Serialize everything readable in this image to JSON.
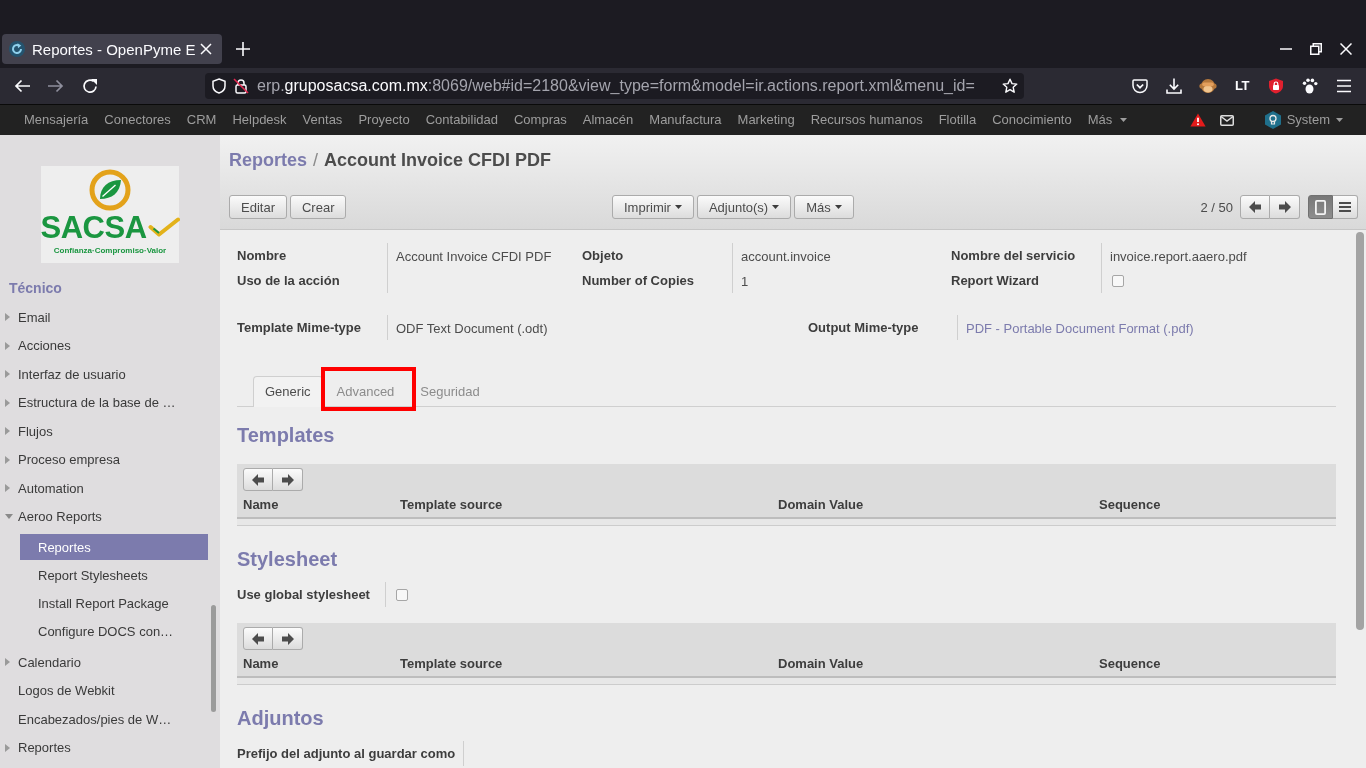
{
  "browser": {
    "tab_title": "Reportes - OpenPyme E",
    "address": {
      "subdomain": "erp.",
      "domain": "gruposacsa.com.mx",
      "path": ":8069/web#id=2180&view_type=form&model=ir.actions.report.xml&menu_id="
    },
    "extension_label": "LT"
  },
  "menu_bar": {
    "items": [
      "Mensajería",
      "Conectores",
      "CRM",
      "Helpdesk",
      "Ventas",
      "Proyecto",
      "Contabilidad",
      "Compras",
      "Almacén",
      "Manufactura",
      "Marketing",
      "Recursos humanos",
      "Flotilla",
      "Conocimiento"
    ],
    "more": "Más",
    "user": "System"
  },
  "sidebar": {
    "logo": {
      "name": "SACSA",
      "tagline": "Confianza·Compromiso·Valor"
    },
    "section": "Técnico",
    "items": [
      {
        "label": "Email",
        "kind": "folder",
        "expanded": false,
        "selected": false
      },
      {
        "label": "Acciones",
        "kind": "folder",
        "expanded": false,
        "selected": false
      },
      {
        "label": "Interfaz de usuario",
        "kind": "folder",
        "expanded": false,
        "selected": false
      },
      {
        "label": "Estructura de la base de …",
        "kind": "folder",
        "expanded": false,
        "selected": false
      },
      {
        "label": "Flujos",
        "kind": "folder",
        "expanded": false,
        "selected": false
      },
      {
        "label": "Proceso empresa",
        "kind": "folder",
        "expanded": false,
        "selected": false
      },
      {
        "label": "Automation",
        "kind": "folder",
        "expanded": false,
        "selected": false
      },
      {
        "label": "Aeroo Reports",
        "kind": "folder",
        "expanded": true,
        "selected": false,
        "children": [
          {
            "label": "Reportes",
            "kind": "leaf",
            "selected": true
          },
          {
            "label": "Report Stylesheets",
            "kind": "leaf",
            "selected": false
          },
          {
            "label": "Install Report Package",
            "kind": "leaf",
            "selected": false
          },
          {
            "label": "Configure DOCS con…",
            "kind": "leaf",
            "selected": false
          }
        ]
      },
      {
        "label": "Calendario",
        "kind": "folder",
        "expanded": false,
        "selected": false
      },
      {
        "label": "Logos de Webkit",
        "kind": "leaf",
        "selected": false
      },
      {
        "label": "Encabezados/pies de W…",
        "kind": "leaf",
        "selected": false
      },
      {
        "label": "Reportes",
        "kind": "folder",
        "expanded": false,
        "selected": false
      }
    ]
  },
  "form": {
    "breadcrumb": {
      "parent": "Reportes",
      "separator": "/",
      "current": "Account Invoice CFDI PDF"
    },
    "buttons": [
      "Editar",
      "Crear"
    ],
    "menus": [
      "Imprimir",
      "Adjunto(s)",
      "Más"
    ],
    "pager": "2 / 50",
    "views": [
      {
        "kind": "form",
        "selected": true
      },
      {
        "kind": "list",
        "selected": false
      }
    ],
    "field_rows": [
      {
        "fields": [
          {
            "label": "Nombre",
            "kind": "text",
            "value": "Account Invoice CFDI PDF"
          },
          {
            "label": "Objeto",
            "kind": "text",
            "value": "account.invoice"
          },
          {
            "label": "Nombre del servicio",
            "kind": "text",
            "value": "invoice.report.aaero.pdf"
          }
        ]
      },
      {
        "fields": [
          {
            "label": "Uso de la acción",
            "kind": "text"
          },
          {
            "label": "Number of Copies",
            "kind": "text",
            "value": "1"
          },
          {
            "label": "Report Wizard",
            "kind": "checkbox",
            "checked": false
          }
        ]
      },
      {
        "fields": [
          {
            "label": "Template Mime-type",
            "kind": "text",
            "value": "ODF Text Document (.odt)"
          },
          {
            "label": "Output Mime-type",
            "kind": "link",
            "value": "PDF - Portable Document Format (.pdf)"
          }
        ]
      }
    ],
    "tabs": [
      {
        "label": "Generic",
        "selected": true,
        "highlighted": false
      },
      {
        "label": "Advanced",
        "selected": false,
        "highlighted": true
      },
      {
        "label": "Seguridad",
        "selected": false,
        "highlighted": false
      }
    ],
    "sections": [
      {
        "title": "Templates",
        "table": {
          "columns": [
            "Name",
            "Template source",
            "Domain Value",
            "Sequence"
          ]
        }
      },
      {
        "title": "Stylesheet",
        "fields": [
          {
            "label": "Use global stylesheet",
            "kind": "checkbox",
            "checked": false
          }
        ],
        "table": {
          "columns": [
            "Name",
            "Template source",
            "Domain Value",
            "Sequence"
          ]
        }
      },
      {
        "title": "Adjuntos",
        "fields": [
          {
            "label": "Prefijo del adjunto al guardar como",
            "kind": "text"
          }
        ]
      }
    ]
  }
}
